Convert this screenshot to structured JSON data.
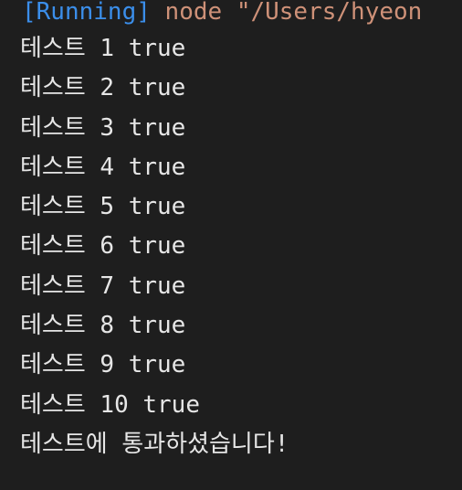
{
  "run": {
    "status": "[Running]",
    "command": "node \"/Users/hyeon"
  },
  "output": [
    "테스트 1 true",
    "테스트 2 true",
    "테스트 3 true",
    "테스트 4 true",
    "테스트 5 true",
    "테스트 6 true",
    "테스트 7 true",
    "테스트 8 true",
    "테스트 9 true",
    "테스트 10 true",
    "테스트에 통과하셨습니다!"
  ],
  "colors": {
    "background": "#1e1e1e",
    "status": "#3b8eea",
    "command": "#ce9178",
    "text": "#e6e6e6"
  }
}
